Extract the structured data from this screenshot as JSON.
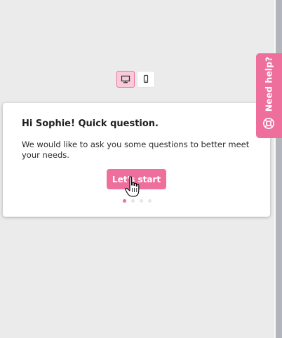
{
  "device_toggle": {
    "options": [
      {
        "icon": "desktop-icon",
        "active": true
      },
      {
        "icon": "mobile-icon",
        "active": false
      }
    ]
  },
  "onboarding": {
    "title": "Hi Sophie! Quick question.",
    "body": "We would like to ask you some questions to better meet your needs.",
    "start_label": "Let's start",
    "steps_total": 4,
    "current_step": 1
  },
  "help_tab": {
    "label": "Need help?",
    "icon": "lifebuoy-icon"
  },
  "colors": {
    "accent": "#ee6f9b",
    "accent_light": "#f8cadb",
    "background": "#ebebeb",
    "card": "#ffffff"
  }
}
